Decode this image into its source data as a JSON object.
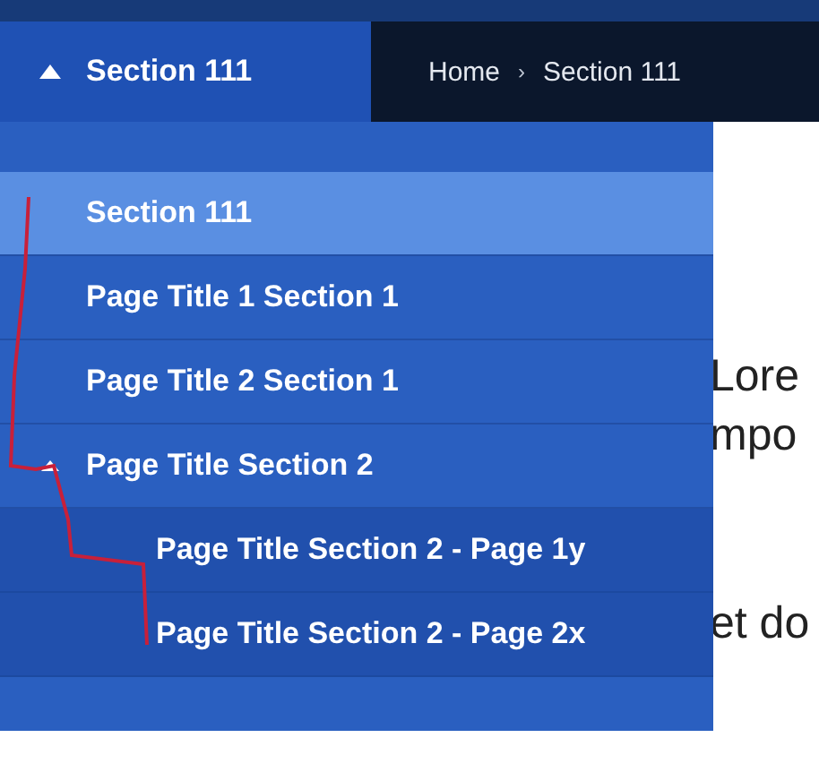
{
  "header": {
    "title": "Section 111",
    "expanded": true
  },
  "breadcrumb": {
    "items": [
      "Home",
      "Section 111"
    ],
    "separator": "›"
  },
  "menu": [
    {
      "label": "Section 111",
      "selected": true
    },
    {
      "label": "Page Title 1 Section 1",
      "selected": false
    },
    {
      "label": "Page Title 2 Section 1",
      "selected": false
    },
    {
      "label": "Page Title Section 2",
      "selected": false,
      "expanded": true,
      "children": [
        {
          "label": "Page Title Section 2 - Page 1y",
          "selected": false
        },
        {
          "label": "Page Title Section 2 - Page 2x",
          "selected": false
        }
      ]
    }
  ],
  "content": [
    "Lore",
    "mpo",
    "et do"
  ]
}
